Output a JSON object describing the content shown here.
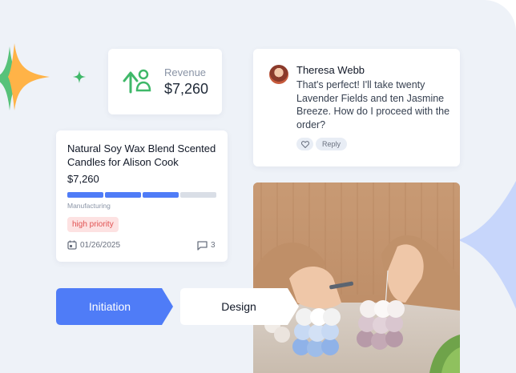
{
  "revenue_card": {
    "label": "Revenue",
    "value": "$7,260",
    "icon": "growth-icon"
  },
  "task_card": {
    "title": "Natural Soy Wax Blend Scented Candles for Alison Cook",
    "amount": "$7,260",
    "stage": "Manufacturing",
    "progress_fraction": 0.75,
    "progress_segments": 4,
    "progress_done": 3,
    "priority": "high priority",
    "date": "01/26/2025",
    "comments": "3"
  },
  "message_card": {
    "author": "Theresa Webb",
    "text": "That's perfect! I'll take twenty Lavender Fields and ten Jasmine Breeze. How do I proceed with the order?",
    "reply_label": "Reply"
  },
  "pipeline": {
    "steps": [
      "Initiation",
      "Design"
    ],
    "active": "Initiation"
  },
  "colors": {
    "accent": "#4f7cf7",
    "green": "#3fb869",
    "orange": "#ffb347",
    "priority_bg": "#fde2e2",
    "priority_text": "#e05252",
    "background": "#eef2f8"
  }
}
